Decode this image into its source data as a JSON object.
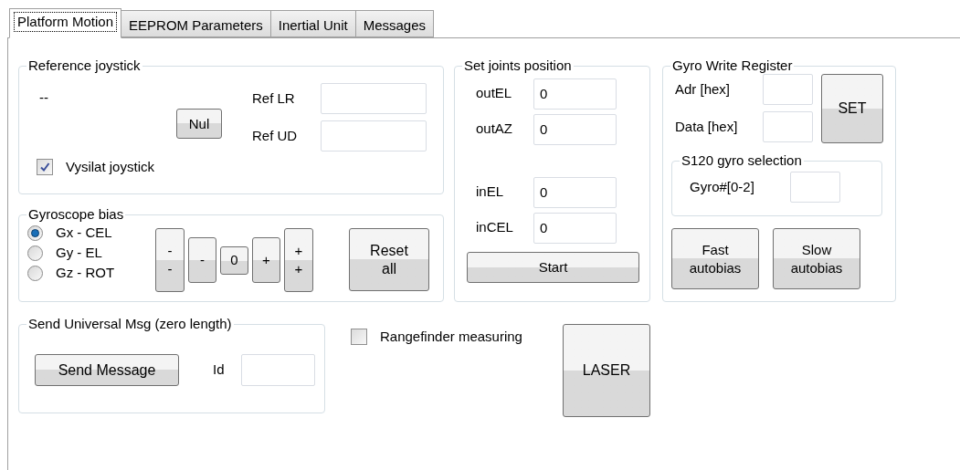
{
  "tabs": [
    {
      "label": "Platform Motion",
      "selected": true
    },
    {
      "label": "EEPROM Parameters",
      "selected": false
    },
    {
      "label": "Inertial Unit",
      "selected": false
    },
    {
      "label": "Messages",
      "selected": false
    }
  ],
  "reference_joystick": {
    "title": "Reference joystick",
    "status": "--",
    "null_button": "Nul",
    "fields": [
      {
        "label": "Ref LR"
      },
      {
        "label": "Ref UD"
      }
    ],
    "checkbox": {
      "label": "Vysilat joystick",
      "checked": true
    }
  },
  "gyroscope_bias": {
    "title": "Gyroscope bias",
    "axes": [
      {
        "label": "Gx - CEL",
        "selected": true
      },
      {
        "label": "Gy - EL",
        "selected": false
      },
      {
        "label": "Gz - ROT",
        "selected": false
      }
    ],
    "step_buttons": [
      {
        "lines": [
          "-",
          "-"
        ]
      },
      {
        "lines": [
          "-"
        ]
      },
      {
        "lines": [
          "0"
        ]
      },
      {
        "lines": [
          "+"
        ]
      },
      {
        "lines": [
          "+",
          "+"
        ]
      }
    ],
    "reset_button": {
      "lines": [
        "Reset",
        "all"
      ]
    }
  },
  "set_joints_position": {
    "title": "Set joints position",
    "out_fields": [
      {
        "label": "outEL",
        "value": "0"
      },
      {
        "label": "outAZ",
        "value": "0"
      }
    ],
    "in_fields": [
      {
        "label": "inEL",
        "value": "0"
      },
      {
        "label": "inCEL",
        "value": "0"
      }
    ],
    "start_button": "Start"
  },
  "gyro_write_register": {
    "title": "Gyro Write Register",
    "fields": [
      {
        "label": "Adr [hex]"
      },
      {
        "label": "Data [hex]"
      }
    ],
    "set_button": "SET",
    "selection": {
      "title": "S120 gyro selection",
      "label": "Gyro#[0-2]"
    },
    "autobias_buttons": [
      {
        "lines": [
          "Fast",
          "autobias"
        ]
      },
      {
        "lines": [
          "Slow",
          "autobias"
        ]
      }
    ]
  },
  "send_universal_msg": {
    "title": "Send Universal Msg (zero length)",
    "send_button": "Send Message",
    "id_label": "Id"
  },
  "rangefinder": {
    "label": "Rangefinder measuring",
    "checked": false
  },
  "laser_button": "LASER"
}
